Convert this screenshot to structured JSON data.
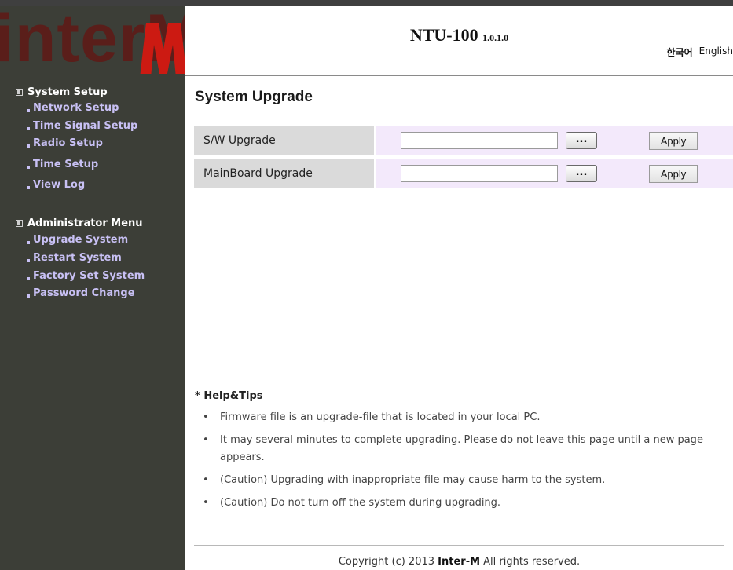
{
  "brand": {
    "logo_text": "interM"
  },
  "header": {
    "product": "NTU-100",
    "version": "1.0.1.0",
    "languages": [
      "한국어",
      "English"
    ]
  },
  "sidebar": {
    "sections": [
      {
        "title": "System Setup",
        "items": [
          "Network Setup",
          "Time Signal Setup",
          "Radio Setup",
          "Time Setup",
          "View Log"
        ]
      },
      {
        "title": "Administrator Menu",
        "items": [
          "Upgrade System",
          "Restart System",
          "Factory Set System",
          "Password Change"
        ]
      }
    ]
  },
  "main": {
    "title": "System Upgrade",
    "rows": [
      {
        "label": "S/W Upgrade",
        "file_value": "",
        "browse_label": "...",
        "apply_label": "Apply"
      },
      {
        "label": "MainBoard Upgrade",
        "file_value": "",
        "browse_label": "...",
        "apply_label": "Apply"
      }
    ]
  },
  "help": {
    "title": "* Help&Tips",
    "tips": [
      "Firmware file is an upgrade-file that is located in your local PC.",
      "It may several minutes to complete upgrading. Please do not leave this page until a new page appears.",
      "(Caution) Upgrading with inappropriate file may cause harm to the system.",
      "(Caution) Do not turn off the system during upgrading."
    ]
  },
  "footer": {
    "prefix": "Copyright (c) 2013 ",
    "company": "Inter-M",
    "suffix": " All rights reserved."
  },
  "colors": {
    "sidebar_bg": "#3c3e37",
    "menu_link": "#c8c0f4",
    "logo": "#5a1e1a",
    "logo_m_accent": "#cc1a12",
    "label_bg": "#dadada",
    "cell_bg": "#f3e9fb"
  }
}
